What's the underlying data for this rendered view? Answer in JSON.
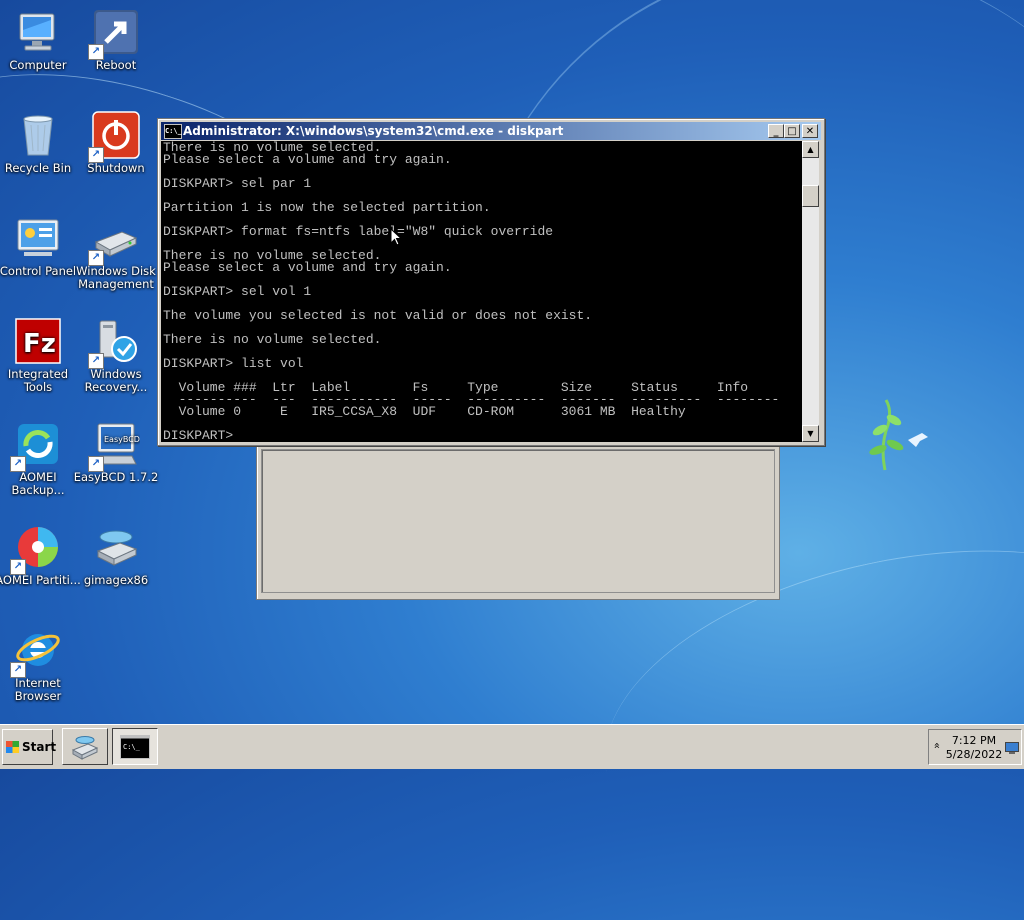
{
  "desktop": {
    "icons": [
      {
        "label": "Computer"
      },
      {
        "label": "Reboot"
      },
      {
        "label": "Recycle Bin"
      },
      {
        "label": "Shutdown"
      },
      {
        "label": "Control Panel"
      },
      {
        "label": "Windows Disk Management"
      },
      {
        "label": "Integrated Tools"
      },
      {
        "label": "Windows Recovery..."
      },
      {
        "label": "AOMEI Backup..."
      },
      {
        "label": "EasyBCD 1.7.2"
      },
      {
        "label": "AOMEI Partiti..."
      },
      {
        "label": "gimagex86"
      },
      {
        "label": "Internet Browser"
      }
    ]
  },
  "cmd_window": {
    "title": "Administrator: X:\\windows\\system32\\cmd.exe - diskpart",
    "icon_text": "C:\\_",
    "minimize": "_",
    "maximize": "□",
    "close": "✕",
    "scroll_up": "▲",
    "scroll_down": "▼",
    "lines": [
      "There is no volume selected.",
      "Please select a volume and try again.",
      "",
      "DISKPART> sel par 1",
      "",
      "Partition 1 is now the selected partition.",
      "",
      "DISKPART> format fs=ntfs label=\"W8\" quick override",
      "",
      "There is no volume selected.",
      "Please select a volume and try again.",
      "",
      "DISKPART> sel vol 1",
      "",
      "The volume you selected is not valid or does not exist.",
      "",
      "There is no volume selected.",
      "",
      "DISKPART> list vol",
      "",
      "  Volume ###  Ltr  Label        Fs     Type        Size     Status     Info",
      "  ----------  ---  -----------  -----  ----------  -------  ---------  --------",
      "  Volume 0     E   IR5_CCSA_X8  UDF    CD-ROM      3061 MB  Healthy",
      "",
      "DISKPART> "
    ]
  },
  "taskbar": {
    "start_label": "Start",
    "tray_arrow": "»",
    "time": "7:12 PM",
    "date": "5/28/2022"
  },
  "colors": {
    "title_start": "#0a246a",
    "title_end": "#a6caf0",
    "console_bg": "#000000",
    "console_fg": "#c0c0c0"
  }
}
